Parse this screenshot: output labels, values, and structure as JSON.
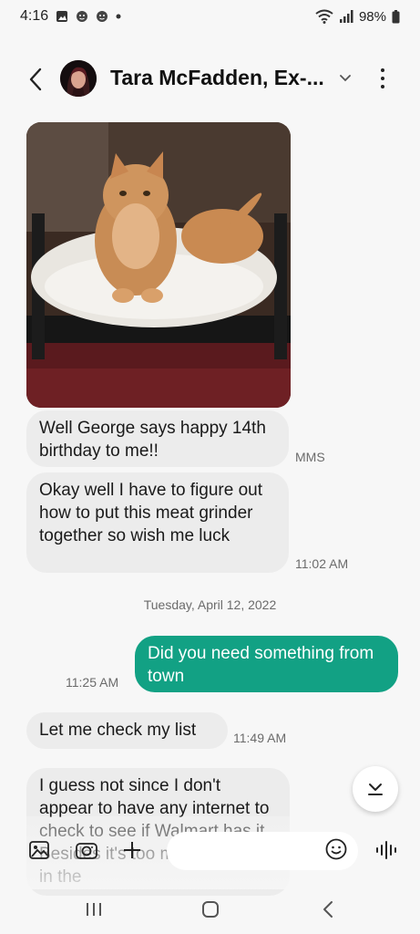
{
  "status_bar": {
    "time": "4:16",
    "battery": "98%",
    "icons": [
      "gallery-notification-icon",
      "face-notification-icon",
      "face-notification-icon",
      "dot-icon",
      "wifi-icon",
      "signal-icon",
      "battery-icon"
    ]
  },
  "header": {
    "contact_name": "Tara McFadden, Ex-...",
    "icons": [
      "back-arrow-icon",
      "avatar",
      "chevron-down-icon",
      "more-vertical-icon"
    ]
  },
  "messages": [
    {
      "direction": "in",
      "type": "image",
      "alt": "cat-photo"
    },
    {
      "direction": "in",
      "text": "Well George says happy 14th birthday to me!!",
      "meta": "MMS"
    },
    {
      "direction": "in",
      "text": "Okay well I have to figure out how to put this meat grinder together so wish me luck",
      "meta": "11:02 AM"
    },
    {
      "direction": "out",
      "text": "Did you need something from town",
      "meta": "11:25 AM"
    },
    {
      "direction": "in",
      "text": "Let me check my list",
      "meta": "11:49 AM"
    },
    {
      "direction": "in",
      "text": "I guess not since I don't appear to have any internet to check to see if Walmart has it. Besides it's too much of a pain in the",
      "meta": ""
    }
  ],
  "date_separator": "Tuesday, April 12, 2022",
  "compose": {
    "placeholder": "",
    "icons": [
      "gallery-icon",
      "camera-icon",
      "plus-icon",
      "emoji-icon",
      "voice-wave-icon"
    ]
  },
  "scroll_down_icon": "chevron-down-icon",
  "nav_bar": {
    "icons": [
      "recent-apps-icon",
      "home-icon",
      "back-icon"
    ]
  },
  "colors": {
    "outgoing_bubble": "#12a184",
    "incoming_bubble": "#ececec",
    "background": "#f7f7f7"
  }
}
